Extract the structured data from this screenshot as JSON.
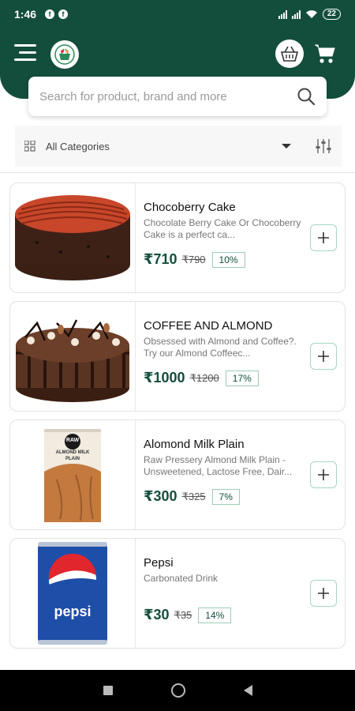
{
  "status_bar": {
    "time": "1:46",
    "notif_icons": [
      "f",
      "f"
    ],
    "battery": "22"
  },
  "header": {
    "menu_icon": "menu-icon",
    "logo_icon": "basket-logo-icon",
    "basket_icon": "basket-icon",
    "cart_icon": "cart-icon"
  },
  "search": {
    "placeholder": "Search for product, brand and more"
  },
  "categories": {
    "selected": "All Categories"
  },
  "products": [
    {
      "name": "Chocoberry Cake",
      "description": "Chocolate Berry Cake Or Chocoberry Cake is a perfect ca...",
      "price": "₹710",
      "mrp": "₹790",
      "discount": "10%"
    },
    {
      "name": "COFFEE AND ALMOND",
      "description": "Obsessed with Almond and Coffee?. Try our Almond Coffeec...",
      "price": "₹1000",
      "mrp": "₹1200",
      "discount": "17%"
    },
    {
      "name": "Alomond Milk Plain",
      "description": "Raw Pressery Almond Milk Plain - Unsweetened, Lactose Free, Dair...",
      "price": "₹300",
      "mrp": "₹325",
      "discount": "7%"
    },
    {
      "name": "Pepsi",
      "description": "Carbonated Drink",
      "price": "₹30",
      "mrp": "₹35",
      "discount": "14%"
    }
  ],
  "product_images": {
    "raw_logo": "RAW",
    "raw_label": "ALMOND MILK PLAIN",
    "pepsi_label": "pepsi"
  },
  "colors": {
    "primary": "#134e3c",
    "accent_border": "#a8d6c2"
  }
}
